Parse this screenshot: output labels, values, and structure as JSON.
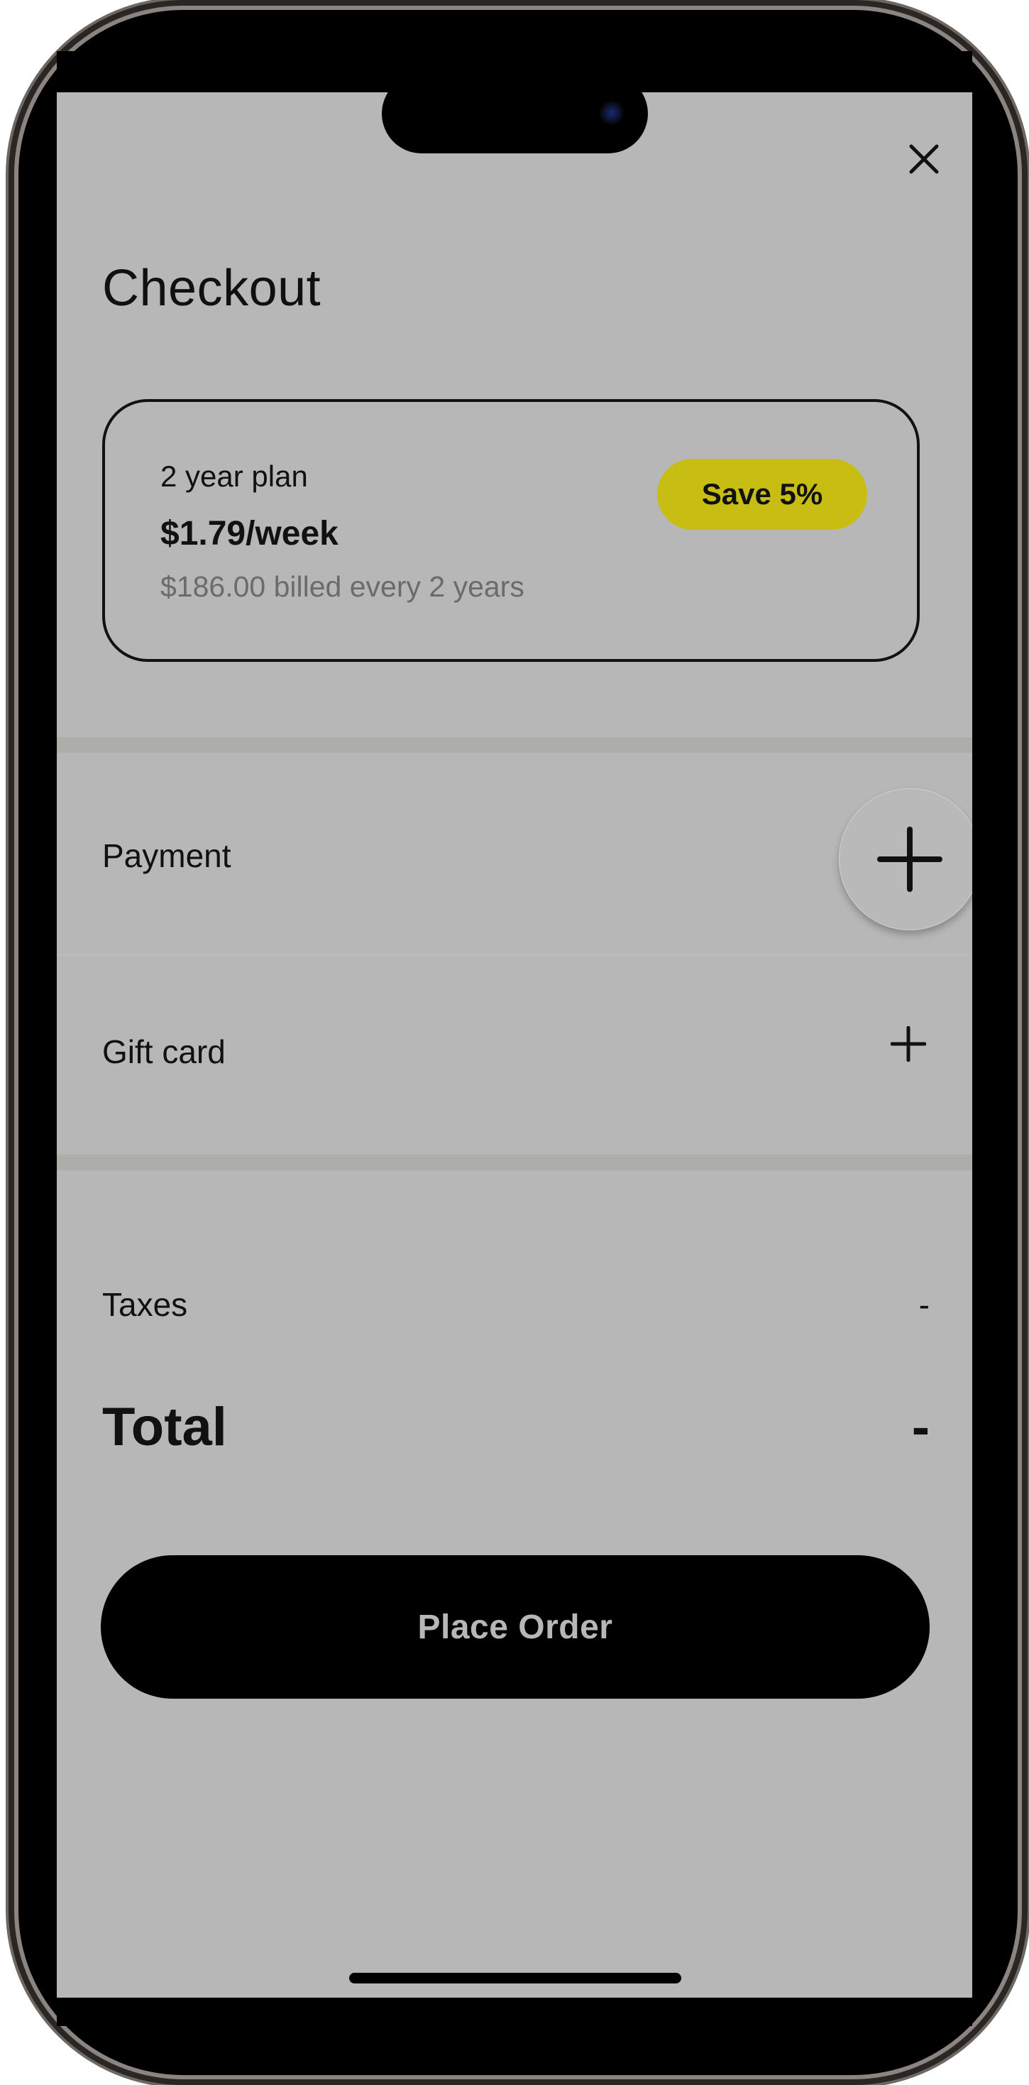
{
  "header": {
    "title": "Checkout",
    "close_icon": "close-icon"
  },
  "plan": {
    "name": "2 year plan",
    "price": "$1.79/week",
    "billing": "$186.00 billed every 2 years",
    "badge": "Save 5%",
    "badge_color": "#c7bd13"
  },
  "payment": {
    "label": "Payment",
    "add_icon": "plus-icon"
  },
  "gift_card": {
    "label": "Gift card",
    "add_icon": "plus-icon"
  },
  "summary": {
    "taxes_label": "Taxes",
    "taxes_value": "-",
    "total_label": "Total",
    "total_value": "-"
  },
  "actions": {
    "place_order_label": "Place Order"
  },
  "colors": {
    "screen_background": "#b7b7b7",
    "primary_button": "#000000"
  }
}
